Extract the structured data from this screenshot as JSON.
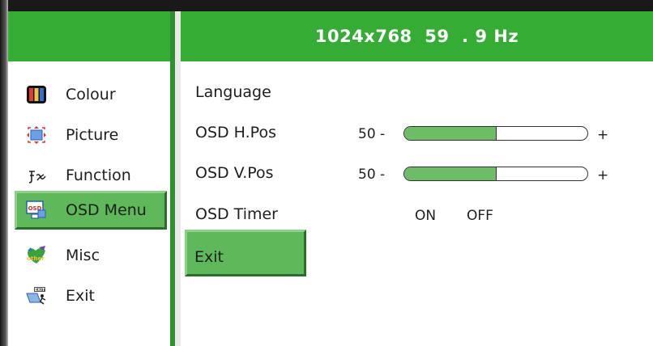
{
  "header": {
    "resolution": "1024x768  59  . 9 Hz"
  },
  "menu": [
    {
      "id": "colour",
      "label": "Colour",
      "icon": "colour-bars-icon"
    },
    {
      "id": "picture",
      "label": "Picture",
      "icon": "picture-position-icon"
    },
    {
      "id": "function",
      "label": "Function",
      "icon": "function-fx-icon"
    },
    {
      "id": "osd-menu",
      "label": "OSD Menu",
      "icon": "osd-icon",
      "icon_text": "OSD",
      "active": true
    },
    {
      "id": "misc",
      "label": "Misc",
      "icon": "misc-other-icon",
      "icon_text": "other"
    },
    {
      "id": "exit",
      "label": "Exit",
      "icon": "exit-icon",
      "icon_text": "EXIT"
    }
  ],
  "osd": {
    "language_label": "Language",
    "hpos": {
      "label": "OSD H.Pos",
      "value_text": "50  -",
      "value": 50,
      "max": 100,
      "plus": "+"
    },
    "vpos": {
      "label": "OSD V.Pos",
      "value_text": "50  -",
      "value": 50,
      "max": 100,
      "plus": "+"
    },
    "timer": {
      "label": "OSD Timer",
      "on": "ON",
      "off": "OFF"
    },
    "exit_label": "Exit"
  },
  "colors": {
    "accent_green": "#35ad35",
    "selected_green": "#5fb85a",
    "slider_fill": "#6cbd66"
  }
}
